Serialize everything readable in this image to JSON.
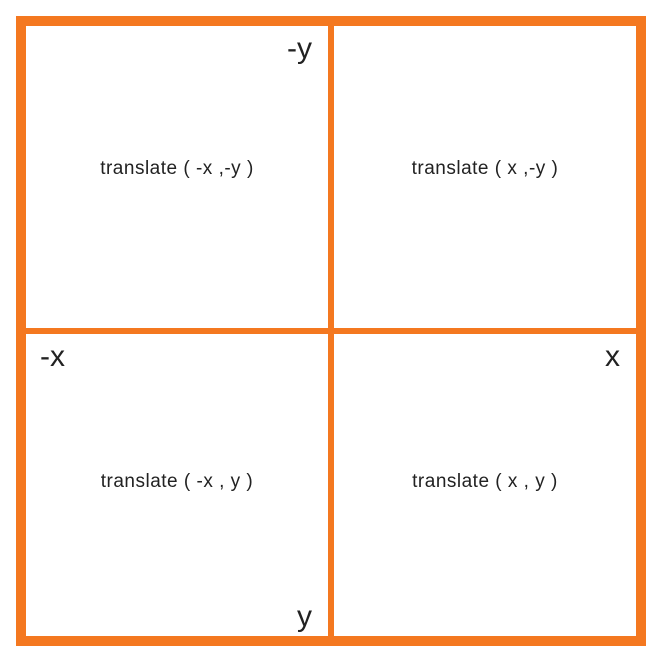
{
  "axes": {
    "neg_y": "-y",
    "neg_x": "-x",
    "pos_x": "x",
    "pos_y": "y"
  },
  "quadrants": {
    "top_left": "translate ( -x ,-y )",
    "top_right": "translate ( x ,-y )",
    "bottom_left": "translate ( -x , y )",
    "bottom_right": "translate ( x , y )"
  },
  "colors": {
    "border": "#f47820"
  }
}
